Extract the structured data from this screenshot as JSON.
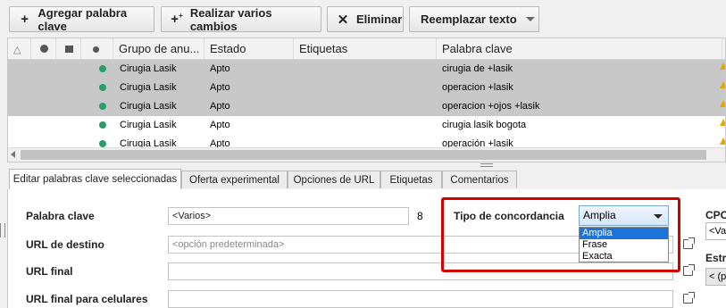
{
  "toolbar": {
    "add_keyword": "Agregar palabra clave",
    "multiple_changes": "Realizar varios cambios",
    "delete": "Eliminar",
    "replace_text": "Reemplazar texto"
  },
  "grid": {
    "columns": [
      "Grupo de anu...",
      "Estado",
      "Etiquetas",
      "Palabra clave"
    ],
    "rows": [
      {
        "group": "Cirugia Lasik",
        "status": "Apto",
        "labels": "",
        "keyword": "cirugia de +lasik",
        "selected": true
      },
      {
        "group": "Cirugia Lasik",
        "status": "Apto",
        "labels": "",
        "keyword": "operacion +lasik",
        "selected": true
      },
      {
        "group": "Cirugia Lasik",
        "status": "Apto",
        "labels": "",
        "keyword": "operacion +ojos +lasik",
        "selected": true
      },
      {
        "group": "Cirugia Lasik",
        "status": "Apto",
        "labels": "",
        "keyword": "cirugia lasik bogota",
        "selected": false
      },
      {
        "group": "Cirugia Lasik",
        "status": "Apto",
        "labels": "",
        "keyword": "operación +lasik",
        "selected": false
      }
    ],
    "status_dot_color": "#2a9d6e",
    "selected_row_color": "#c8c8c8"
  },
  "tabs": [
    "Editar palabras clave seleccionadas",
    "Oferta experimental",
    "Opciones de URL",
    "Etiquetas",
    "Comentarios"
  ],
  "form": {
    "keyword_label": "Palabra clave",
    "keyword_value": "<Varios>",
    "keyword_count": "8",
    "dest_url_label": "URL de destino",
    "dest_url_placeholder": "<opción predeterminada>",
    "final_url_label": "URL final",
    "mobile_final_url_label": "URL final para celulares",
    "match_type_label": "Tipo de concordancia",
    "match_type_value": "Amplia",
    "match_type_options": [
      "Amplia",
      "Frase",
      "Exacta"
    ],
    "cpc_label": "CPC",
    "cpc_value": "<Va",
    "strategy_label": "Estra",
    "strategy_value": "< (p"
  },
  "highlight_color": "#d40000"
}
